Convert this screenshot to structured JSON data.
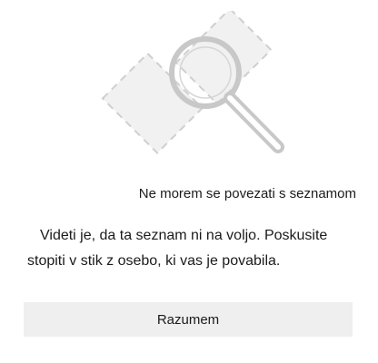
{
  "dialog": {
    "illustration_icon": "magnifier-search-icon",
    "title": "Ne morem se povezati s seznamom",
    "message": "Videti je, da ta seznam ni na voljo. Poskusite stopiti v stik z osebo, ki vas je povabila.",
    "button_label": "Razumem"
  },
  "colors": {
    "illustration_stroke": "#cfcfcf",
    "illustration_fill": "#efefef",
    "button_background": "#efefef",
    "text": "#1b1b1b"
  }
}
